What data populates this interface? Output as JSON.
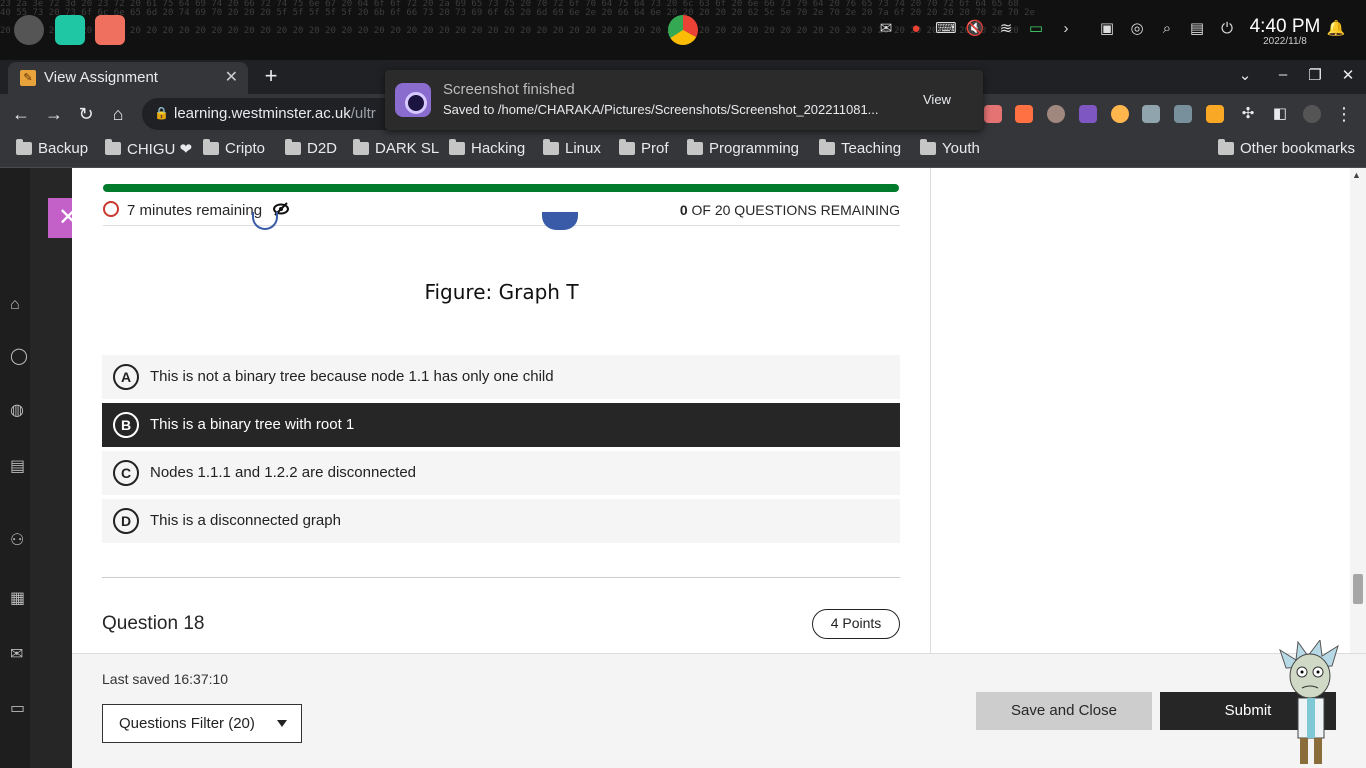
{
  "os": {
    "clock_time": "4:40 PM",
    "clock_date": "2022/11/8"
  },
  "browser": {
    "tab_title": "View Assignment",
    "url_host": "learning.westminster.ac.uk",
    "url_path": "/ultr",
    "bookmarks": [
      "Backup",
      "CHIGU ❤",
      "Cripto",
      "D2D",
      "DARK SL",
      "Hacking",
      "Linux",
      "Prof",
      "Programming",
      "Teaching",
      "Youth"
    ],
    "other_bookmarks": "Other bookmarks"
  },
  "notification": {
    "title": "Screenshot finished",
    "message": "Saved to /home/CHARAKA/Pictures/Screenshots/Screenshot_202211081...",
    "action": "View"
  },
  "assessment": {
    "progress_fraction": 1.0,
    "timer_text": "7 minutes remaining",
    "remaining_count": "0",
    "remaining_text": " OF 20 QUESTIONS REMAINING",
    "figure_caption": "Figure: Graph T",
    "options": [
      {
        "letter": "A",
        "text": "This is not a binary tree because node 1.1 has only one child",
        "selected": false
      },
      {
        "letter": "B",
        "text": "This is a binary tree with root 1",
        "selected": true
      },
      {
        "letter": "C",
        "text": "Nodes 1.1.1 and 1.2.2 are disconnected",
        "selected": false
      },
      {
        "letter": "D",
        "text": "This is a disconnected graph",
        "selected": false
      }
    ],
    "next_question_title": "Question 18",
    "next_question_points": "4 Points"
  },
  "footer": {
    "last_saved": "Last saved 16:37:10",
    "questions_filter": "Questions Filter (20)",
    "save_close_label": "Save and Close",
    "submit_label": "Submit"
  },
  "colors": {
    "progress": "#037b2d",
    "selected_option": "#262626",
    "accent_close": "#c461c9"
  }
}
